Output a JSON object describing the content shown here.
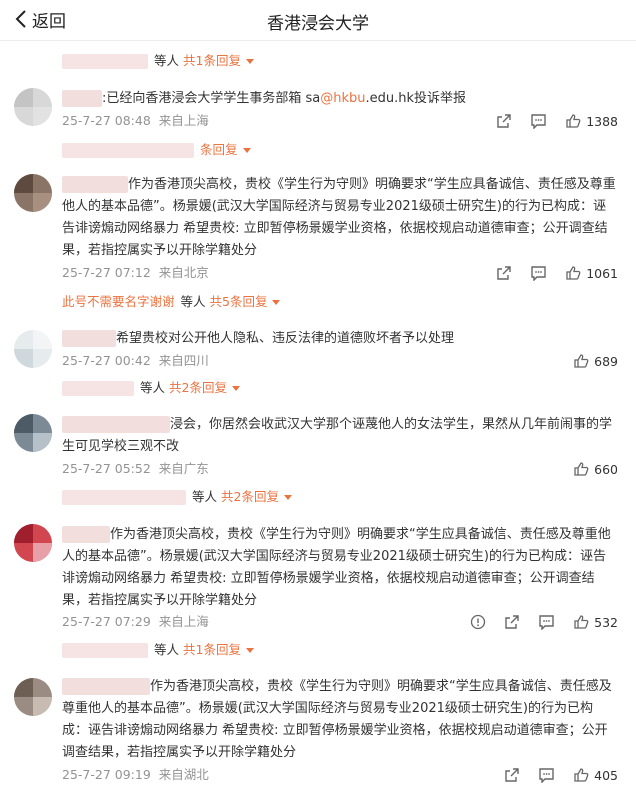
{
  "header": {
    "back_label": "返回",
    "title": "香港浸会大学"
  },
  "comments": [
    {
      "kind": "reply_only",
      "reply": {
        "people": "等人",
        "count": "共1条回复"
      }
    },
    {
      "text_pre": ":已经向香港浸会大学学生事务部箱 sa",
      "text_link": "@hkbu",
      "text_post": ".edu.hk投诉举报",
      "time": "25-7-27 08:48",
      "loc": "来自上海",
      "likes": "1388",
      "reply": {
        "count": "条回复"
      }
    },
    {
      "text": "作为香港顶尖高校，贵校《学生行为守则》明确要求“学生应具备诚信、责任感及尊重他人的基本品德”。杨景媛(武汉大学国际经济与贸易专业2021级硕士研究生)的行为已构成：诬告诽谤煽动网络暴力 希望贵校: 立即暂停杨景媛学业资格，依据校规启动道德审查；公开调查结果，若指控属实予以开除学籍处分",
      "time": "25-7-27 07:12",
      "loc": "来自北京",
      "likes": "1061",
      "reply": {
        "highlight": "此号不需要名字谢谢",
        "people": "等人",
        "count": "共5条回复"
      }
    },
    {
      "text": "希望贵校对公开他人隐私、违反法律的道德败坏者予以处理",
      "time": "25-7-27 00:42",
      "loc": "来自四川",
      "likes": "689",
      "reply": {
        "people": "等人",
        "count": "共2条回复"
      }
    },
    {
      "text": "浸会，你居然会收武汉大学那个诬蔑他人的女法学生，果然从几年前闹事的学生可见学校三观不改",
      "time": "25-7-27 05:52",
      "loc": "来自广东",
      "likes": "660",
      "reply": {
        "people": "等人",
        "count": "共2条回复"
      }
    },
    {
      "text": "作为香港顶尖高校，贵校《学生行为守则》明确要求“学生应具备诚信、责任感及尊重他人的基本品德”。杨景媛(武汉大学国际经济与贸易专业2021级硕士研究生)的行为已构成：诬告诽谤煽动网络暴力 希望贵校: 立即暂停杨景媛学业资格，依据校规启动道德审查；公开调查结果，若指控属实予以开除学籍处分",
      "time": "25-7-27 07:29",
      "loc": "来自上海",
      "likes": "532",
      "reply": {
        "people": "等人",
        "count": "共1条回复"
      }
    },
    {
      "text": "作为香港顶尖高校，贵校《学生行为守则》明确要求“学生应具备诚信、责任感及尊重他人的基本品德”。杨景媛(武汉大学国际经济与贸易专业2021级硕士研究生)的行为已构成：诬告诽谤煽动网络暴力 希望贵校: 立即暂停杨景媛学业资格，依据校规启动道德审查；公开调查结果，若指控属实予以开除学籍处分",
      "time": "25-7-27 09:19",
      "loc": "来自湖北",
      "likes": "405"
    }
  ],
  "icons": {
    "back": "chevron-left-icon",
    "share": "share-icon",
    "comment": "comment-icon",
    "like": "thumbs-up-icon",
    "info": "info-circle-icon"
  },
  "colors": {
    "accent": "#eb7340",
    "meta": "#939393",
    "blur": "#f3dede"
  }
}
